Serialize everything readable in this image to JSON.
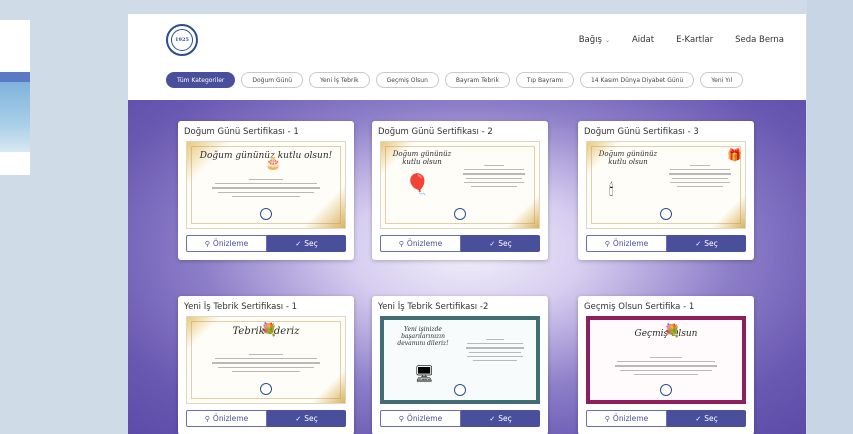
{
  "header": {
    "logo_text": "1925",
    "nav": [
      {
        "label": "Bağış",
        "has_dropdown": true
      },
      {
        "label": "Aidat"
      },
      {
        "label": "E-Kartlar"
      },
      {
        "label": "Seda Berna"
      }
    ]
  },
  "tabs": [
    {
      "label": "Tüm Kategoriler",
      "active": true
    },
    {
      "label": "Doğum Günü"
    },
    {
      "label": "Yeni İş Tebrik"
    },
    {
      "label": "Geçmiş Olsun"
    },
    {
      "label": "Bayram Tebrik"
    },
    {
      "label": "Tıp Bayramı"
    },
    {
      "label": "14 Kasım Dünya Diyabet Günü"
    },
    {
      "label": "Yeni Yıl"
    }
  ],
  "cards": [
    {
      "title": "Doğum Günü Sertifikası - 1",
      "heading": "Doğum gününüz kutlu olsun!",
      "border_color": "#c9a14a",
      "bg": "#fffdf7"
    },
    {
      "title": "Doğum Günü Sertifikası - 2",
      "heading": "Doğum gününüz kutlu olsun",
      "border_color": "#c9a14a",
      "bg": "#fffdf7"
    },
    {
      "title": "Doğum Günü Sertifikası - 3",
      "heading": "Doğum gününüz kutlu olsun",
      "border_color": "#c9a14a",
      "bg": "#fffdf7"
    },
    {
      "title": "Yeni İş Tebrik Sertifikası - 1",
      "heading": "Tebrik ederiz",
      "border_color": "#c9a14a",
      "bg": "#fffdf7"
    },
    {
      "title": "Yeni İş Tebrik Sertifikası -2",
      "heading": "Yeni işinizde başarılarınızın devamını dileriz!",
      "border_color": "#3f6f73",
      "bg": "#f7fbfb"
    },
    {
      "title": "Geçmiş Olsun Sertifika - 1",
      "heading": "Geçmiş Olsun",
      "border_color": "#8e1f5c",
      "bg": "#fffafc"
    }
  ],
  "buttons": {
    "preview_label": "Önizleme",
    "select_label": "Seç",
    "preview_icon": "zoom-icon",
    "select_icon": "check-icon"
  },
  "colors": {
    "primary": "#4a4f9c",
    "background": "#cfdbe7"
  }
}
